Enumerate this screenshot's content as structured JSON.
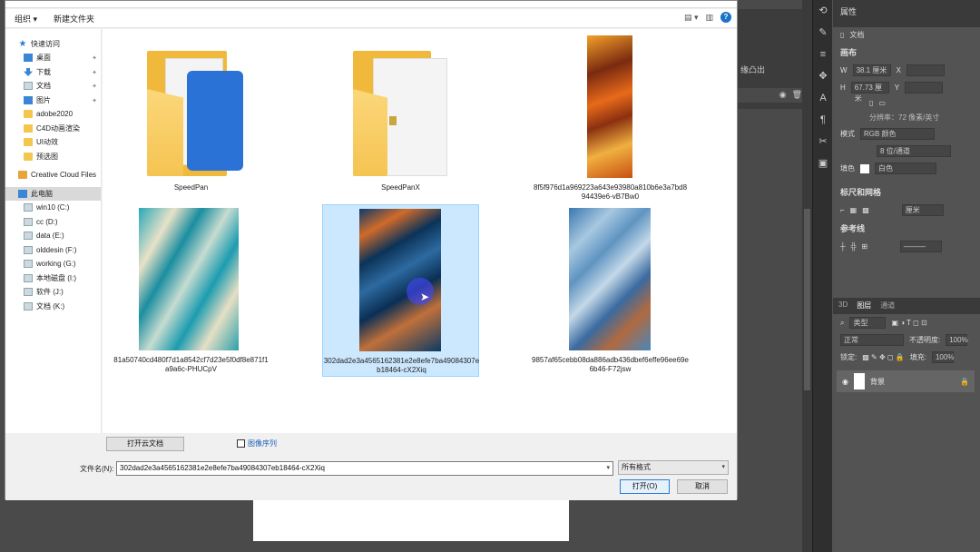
{
  "dialog": {
    "toolbar": {
      "organize": "组织 ▾",
      "new_folder": "新建文件夹"
    },
    "nav": [
      {
        "label": "快速访问",
        "icon": "star-icon"
      },
      {
        "label": "桌面",
        "icon": "desktop-icon"
      },
      {
        "label": "下载",
        "icon": "download-icon"
      },
      {
        "label": "文档",
        "icon": "documents-icon"
      },
      {
        "label": "图片",
        "icon": "pictures-icon"
      },
      {
        "label": "adobe2020",
        "icon": "folder-icon"
      },
      {
        "label": "C4D动画渲染",
        "icon": "folder-icon"
      },
      {
        "label": "UI动效",
        "icon": "folder-icon"
      },
      {
        "label": "预选图",
        "icon": "folder-icon"
      },
      {
        "label": "Creative Cloud Files",
        "icon": "cloud-folder-icon"
      },
      {
        "label": "此电脑",
        "icon": "pc-icon"
      },
      {
        "label": "win10 (C:)",
        "icon": "drive-icon"
      },
      {
        "label": "cc (D:)",
        "icon": "drive-icon"
      },
      {
        "label": "data (E:)",
        "icon": "drive-icon"
      },
      {
        "label": "olddesin (F:)",
        "icon": "drive-icon"
      },
      {
        "label": "working (G:)",
        "icon": "drive-icon"
      },
      {
        "label": "本地磁盘 (I:)",
        "icon": "drive-icon"
      },
      {
        "label": "软件 (J:)",
        "icon": "drive-icon"
      },
      {
        "label": "文档 (K:)",
        "icon": "drive-icon"
      }
    ],
    "files": [
      {
        "name": "SpeedPan"
      },
      {
        "name": "SpeedPanX"
      },
      {
        "name": "8f5f976d1a969223a643e93980a810b6e3a7bd894439e6-vB7Bw0"
      },
      {
        "name": "81a50740cd480f7d1a8542cf7d23e5f0df8e871f1a9a6c-PHUCpV"
      },
      {
        "name": "302dad2e3a4565162381e2e8efe7ba49084307eb18464-cX2Xiq"
      },
      {
        "name": "9857af65cebb08da886adb436dbef6effe96ee69e6b46-F72jsw"
      }
    ],
    "cloud_btn": "打开云文档",
    "image_sequence": "图像序列",
    "filename_label": "文件名(N):",
    "filename_value": "302dad2e3a4565162381e2e8efe7ba49084307eb18464-cX2Xiq",
    "filetype": "所有格式",
    "open_btn": "打开(O)",
    "cancel_btn": "取消"
  },
  "ps": {
    "properties_tab": "属性",
    "doc_label": "文档",
    "canvas_sec": "画布",
    "w_label": "W",
    "w_value": "38.1 厘米",
    "h_label": "H",
    "h_value": "67.73 厘米",
    "x_label": "X",
    "y_label": "Y",
    "resolution": "分辨率：72 像素/英寸",
    "mode_label": "模式",
    "mode_value": "RGB 颜色",
    "depth_value": "8 位/通道",
    "fill_label": "填色",
    "fill_value": "白色",
    "rulers_sec": "标尺和网格",
    "ruler_unit": "厘米",
    "guides_sec": "参考线",
    "layers_tabs": [
      "3D",
      "图层",
      "通道"
    ],
    "kind_label": "类型",
    "blend_mode": "正常",
    "opacity_label": "不透明度:",
    "opacity_value": "100%",
    "lock_label": "锁定:",
    "fill2_label": "填充:",
    "fill2_value": "100%",
    "layer_name": "背景",
    "midpanel_text": "缘凸出"
  }
}
